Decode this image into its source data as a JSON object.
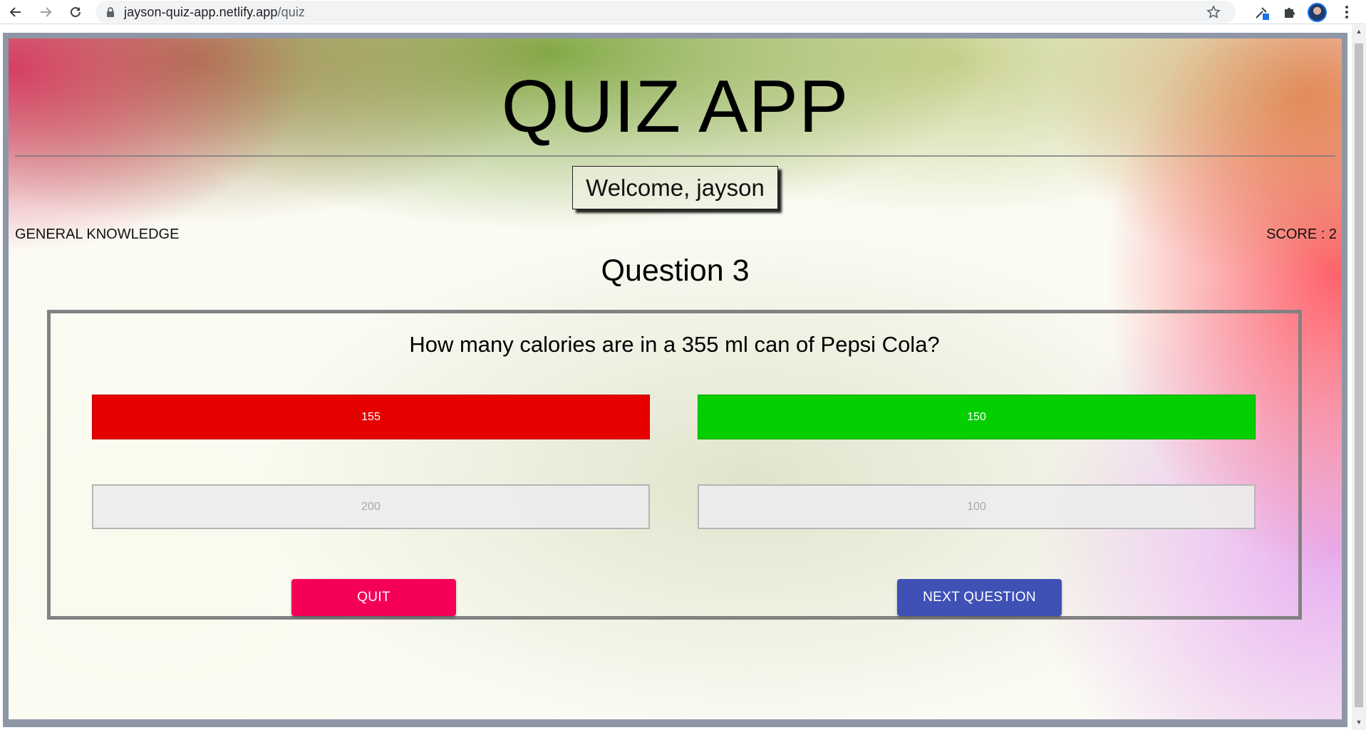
{
  "browser": {
    "url_host": "jayson-quiz-app.netlify.app",
    "url_path": "/quiz"
  },
  "app": {
    "title": "QUIZ APP",
    "welcome": "Welcome, jayson",
    "category": "GENERAL KNOWLEDGE",
    "score": "SCORE : 2",
    "question_heading": "Question 3",
    "question_text": "How many calories are in a 355 ml can of Pepsi Cola?",
    "options": [
      {
        "label": "155",
        "state": "wrong"
      },
      {
        "label": "150",
        "state": "correct"
      },
      {
        "label": "200",
        "state": "disabled"
      },
      {
        "label": "100",
        "state": "disabled"
      }
    ],
    "quit_label": "QUIT",
    "next_label": "NEXT QUESTION"
  },
  "colors": {
    "wrong": "#e60000",
    "correct": "#04cf00",
    "quit": "#f50057",
    "next": "#3f51b5"
  }
}
